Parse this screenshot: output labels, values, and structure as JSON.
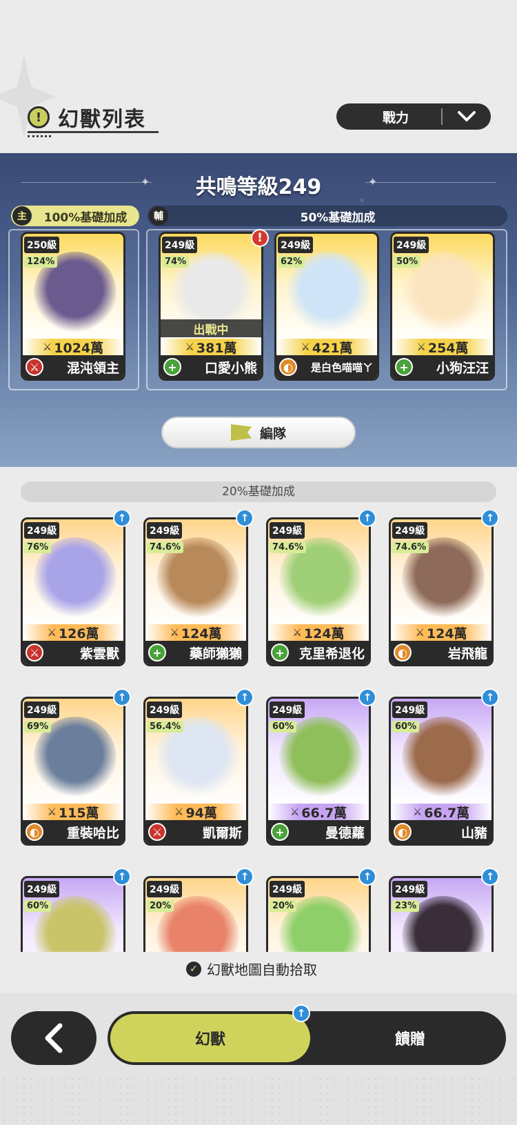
{
  "header": {
    "title": "幻獸列表",
    "title_icon": "alert-icon",
    "sort": {
      "label": "戰力"
    }
  },
  "resonance": {
    "title": "共鳴等級249",
    "main_tag": {
      "badge": "主",
      "text": "100%基礎加成"
    },
    "sub_tag": {
      "badge": "輔",
      "text": "50%基礎加成"
    },
    "team_button": "編隊"
  },
  "main_card": {
    "level": "250級",
    "percent": "124%",
    "power": "1024萬",
    "name": "混沌領主",
    "role": "attack",
    "color": "yellow",
    "art": "#6b5a8e"
  },
  "sub_cards": [
    {
      "level": "249級",
      "percent": "74%",
      "power": "381萬",
      "name": "口愛小熊",
      "role": "heal",
      "color": "yellow",
      "status": "出戰中",
      "alert": "!",
      "art": "#e9e9e9"
    },
    {
      "level": "249級",
      "percent": "62%",
      "power": "421萬",
      "name": "是白色喵喵ㄚ",
      "role": "defense",
      "color": "yellow",
      "art": "#cfe4f7"
    },
    {
      "level": "249級",
      "percent": "50%",
      "power": "254萬",
      "name": "小狗汪汪",
      "role": "heal",
      "color": "yellow",
      "art": "#fbe4c0"
    }
  ],
  "list": {
    "bonus": "20%基礎加成",
    "cards": [
      {
        "level": "249級",
        "percent": "76%",
        "power": "126萬",
        "name": "紫雲獸",
        "role": "attack",
        "color": "orange",
        "art": "#a9a4e8"
      },
      {
        "level": "249級",
        "percent": "74.6%",
        "power": "124萬",
        "name": "藥師獺獺",
        "role": "heal",
        "color": "orange",
        "art": "#b8895a"
      },
      {
        "level": "249級",
        "percent": "74.6%",
        "power": "124萬",
        "name": "克里希退化",
        "role": "heal",
        "color": "orange",
        "art": "#9fcf77"
      },
      {
        "level": "249級",
        "percent": "74.6%",
        "power": "124萬",
        "name": "岩飛龍",
        "role": "defense",
        "color": "orange",
        "art": "#8e6a5a"
      },
      {
        "level": "249級",
        "percent": "69%",
        "power": "115萬",
        "name": "重裝哈比",
        "role": "defense",
        "color": "orange",
        "art": "#6b7f9c"
      },
      {
        "level": "249級",
        "percent": "56.4%",
        "power": "94萬",
        "name": "凱爾斯",
        "role": "attack",
        "color": "orange",
        "art": "#dde6f2"
      },
      {
        "level": "249級",
        "percent": "60%",
        "power": "66.7萬",
        "name": "曼德蘿",
        "role": "heal",
        "color": "purple",
        "art": "#8fbf5a"
      },
      {
        "level": "249級",
        "percent": "60%",
        "power": "66.7萬",
        "name": "山豬",
        "role": "defense",
        "color": "purple",
        "art": "#9c6b4c"
      },
      {
        "level": "249級",
        "percent": "60%",
        "power": "",
        "name": "",
        "role": "",
        "color": "purple",
        "art": "#c9c46a"
      },
      {
        "level": "249級",
        "percent": "20%",
        "power": "",
        "name": "",
        "role": "",
        "color": "orange",
        "art": "#e8836a"
      },
      {
        "level": "249級",
        "percent": "20%",
        "power": "",
        "name": "",
        "role": "",
        "color": "orange",
        "art": "#8fcf6a"
      },
      {
        "level": "249級",
        "percent": "23%",
        "power": "",
        "name": "",
        "role": "",
        "color": "purple",
        "art": "#3a2e3a"
      }
    ]
  },
  "auto_pick": "幻獸地圖自動拾取",
  "nav": {
    "back_icon": "back-arrow-icon",
    "tab_beasts": "幻獸",
    "tab_gift": "饋贈"
  },
  "colors": {
    "accent": "#cfd35c",
    "dark": "#2a2a2a",
    "upgrade": "#2f8ed8"
  }
}
